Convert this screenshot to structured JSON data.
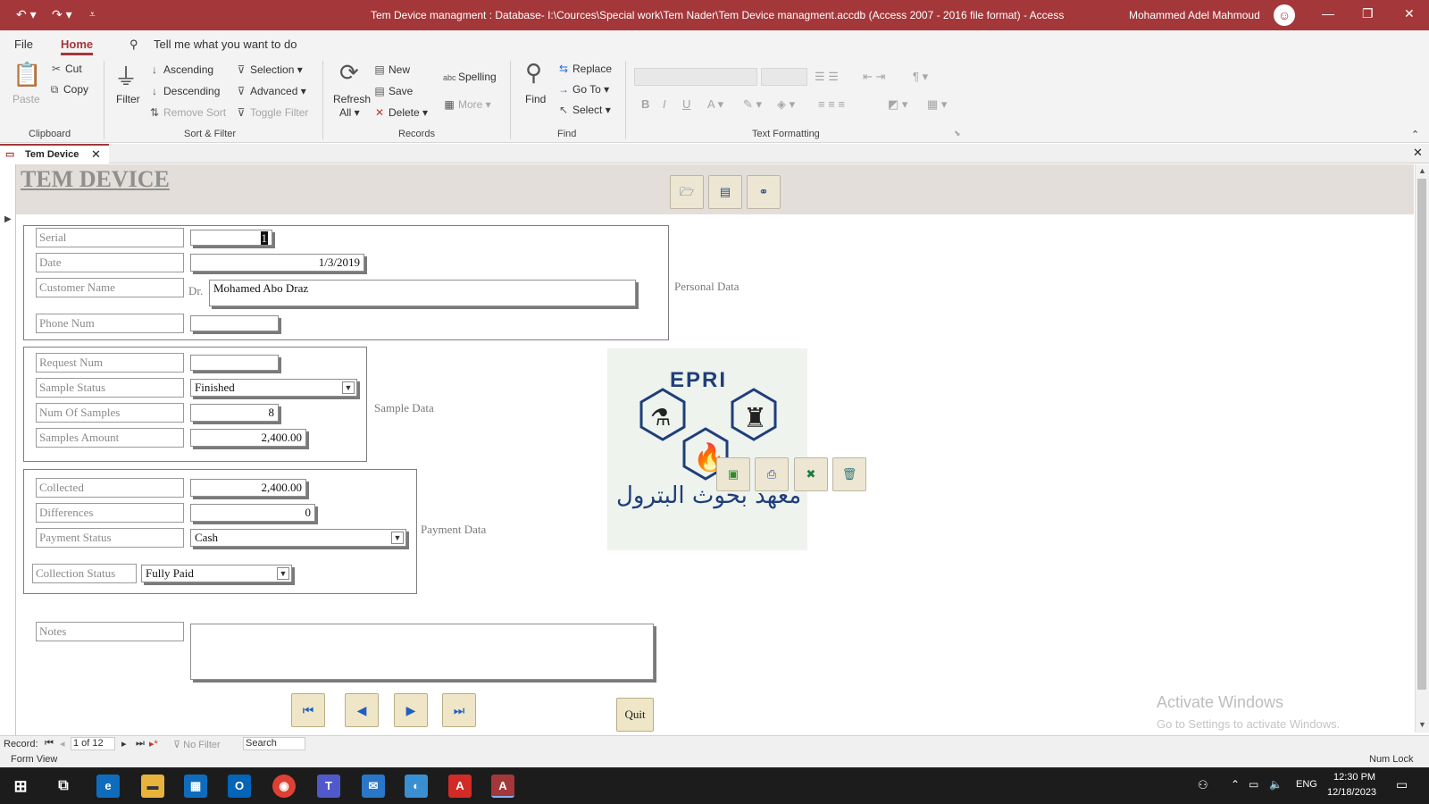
{
  "titlebar": {
    "title": "Tem Device managment : Database- I:\\Cources\\Special work\\Tem Nader\\Tem Device managment.accdb (Access 2007 - 2016 file format)  -  Access",
    "user": "Mohammed Adel Mahmoud"
  },
  "tabs": {
    "file": "File",
    "home": "Home",
    "tell_me": "Tell me what you want to do"
  },
  "ribbon": {
    "clipboard": {
      "paste": "Paste",
      "cut": "Cut",
      "copy": "Copy",
      "group": "Clipboard"
    },
    "sortfilter": {
      "filter": "Filter",
      "ascending": "Ascending",
      "descending": "Descending",
      "remove_sort": "Remove Sort",
      "selection": "Selection",
      "advanced": "Advanced",
      "toggle_filter": "Toggle Filter",
      "group": "Sort & Filter"
    },
    "records": {
      "refresh": "Refresh",
      "all": "All",
      "new": "New",
      "save": "Save",
      "delete": "Delete",
      "spelling": "Spelling",
      "more": "More",
      "group": "Records"
    },
    "find": {
      "find": "Find",
      "replace": "Replace",
      "goto": "Go To",
      "select": "Select",
      "group": "Find"
    },
    "text": {
      "group": "Text Formatting"
    }
  },
  "object_tab": "Tem Device",
  "form": {
    "title": "TEM DEVICE",
    "personal": {
      "section": "Personal Data",
      "serial_label": "Serial",
      "serial": "1",
      "date_label": "Date",
      "date": "1/3/2019",
      "customer_label": "Customer  Name",
      "prefix": "Dr.",
      "customer": "Mohamed Abo Draz",
      "phone_label": "Phone Num",
      "phone": ""
    },
    "sample": {
      "section": "Sample Data",
      "request_label": "Request Num",
      "request": "",
      "status_label": "Sample Status",
      "status": "Finished",
      "num_label": "Num Of Samples",
      "num": "8",
      "amount_label": "Samples Amount",
      "amount": "2,400.00"
    },
    "payment": {
      "section": "Payment Data",
      "collected_label": "Collected",
      "collected": "2,400.00",
      "diff_label": "Differences",
      "diff": "0",
      "status_label": "Payment Status",
      "status": "Cash",
      "collection_label": "Collection Status",
      "collection": "Fully Paid"
    },
    "notes_label": "Notes",
    "notes": "",
    "quit": "Quit",
    "logo": {
      "top": "EPRI",
      "arabic": "معهد بحوث البترول"
    }
  },
  "recnav": {
    "record": "Record:",
    "position": "1 of 12",
    "no_filter": "No Filter",
    "search": "Search"
  },
  "status": {
    "view": "Form View",
    "numlock": "Num Lock"
  },
  "activate": {
    "line1": "Activate Windows",
    "line2": "Go to Settings to activate Windows."
  },
  "taskbar": {
    "lang": "ENG",
    "time": "12:30 PM",
    "date": "12/18/2023"
  },
  "colors": {
    "accent": "#a4373a",
    "form_header": "#e3ded9"
  }
}
